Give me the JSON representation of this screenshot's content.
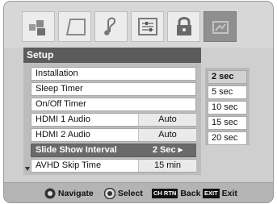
{
  "tabs": [
    {
      "icon": "picture-icon"
    },
    {
      "icon": "screen-icon"
    },
    {
      "icon": "music-note-icon"
    },
    {
      "icon": "settings-sliders-icon"
    },
    {
      "icon": "lock-icon"
    },
    {
      "icon": "setup-icon",
      "active": true
    }
  ],
  "menu": {
    "title": "Setup",
    "items": [
      {
        "label": "Installation",
        "value": ""
      },
      {
        "label": "Sleep Timer",
        "value": ""
      },
      {
        "label": "On/Off Timer",
        "value": ""
      },
      {
        "label": "HDMI 1 Audio",
        "value": "Auto"
      },
      {
        "label": "HDMI 2 Audio",
        "value": "Auto"
      },
      {
        "label": "Slide Show Interval",
        "value": "2 Sec ▸",
        "selected": true
      },
      {
        "label": "AVHD Skip Time",
        "value": "15 min"
      }
    ]
  },
  "options": {
    "items": [
      "2 sec",
      "5 sec",
      "10 sec",
      "15 sec",
      "20 sec"
    ],
    "selected": "2 sec"
  },
  "footer": {
    "navigate_label": "Navigate",
    "select_label": "Select",
    "ch_rtn_key": "CH RTN",
    "back_label": "Back",
    "exit_key": "EXIT",
    "exit_label": "Exit"
  }
}
